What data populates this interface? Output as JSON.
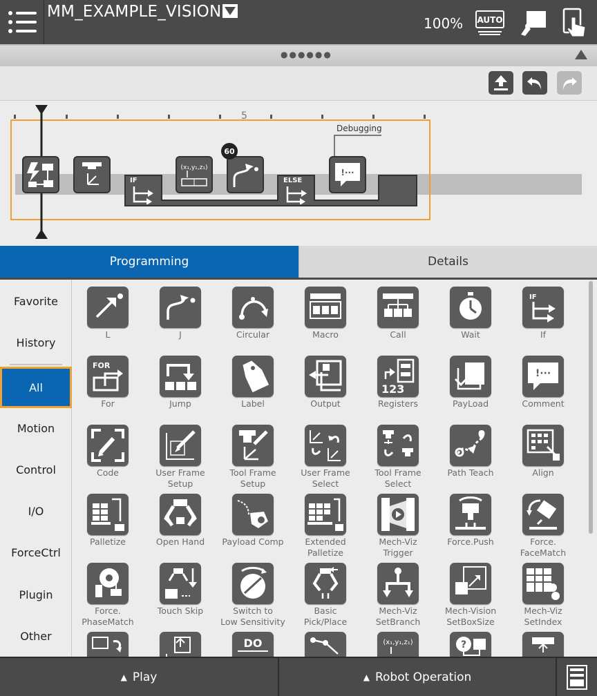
{
  "header": {
    "program_name": "MM_EXAMPLE_VISION",
    "speed": "100%",
    "mode_label": "AUTO"
  },
  "timeline": {
    "ruler_mark": "5",
    "debug_label": "Debugging",
    "wait_badge": "60",
    "if_label": "IF",
    "else_label": "ELSE",
    "coord_label": "(x₁,y₁,z₁)",
    "comment_mark": "!···"
  },
  "tabs": {
    "programming": "Programming",
    "details": "Details"
  },
  "categories": [
    {
      "label": "Favorite"
    },
    {
      "label": "History"
    },
    {
      "label": "All"
    },
    {
      "label": "Motion"
    },
    {
      "label": "Control"
    },
    {
      "label": "I/O"
    },
    {
      "label": "ForceCtrl"
    },
    {
      "label": "Plugin"
    },
    {
      "label": "Other"
    }
  ],
  "selected_category": "All",
  "palette": [
    {
      "label": "L",
      "icon": "linear-move-icon"
    },
    {
      "label": "J",
      "icon": "joint-move-icon"
    },
    {
      "label": "Circular",
      "icon": "circular-move-icon"
    },
    {
      "label": "Macro",
      "icon": "macro-icon"
    },
    {
      "label": "Call",
      "icon": "call-icon"
    },
    {
      "label": "Wait",
      "icon": "stopwatch-icon"
    },
    {
      "label": "If",
      "icon": "if-icon"
    },
    {
      "label": "For",
      "icon": "for-loop-icon"
    },
    {
      "label": "Jump",
      "icon": "jump-icon"
    },
    {
      "label": "Label",
      "icon": "tag-icon"
    },
    {
      "label": "Output",
      "icon": "output-icon"
    },
    {
      "label": "Registers",
      "icon": "registers-icon"
    },
    {
      "label": "PayLoad",
      "icon": "payload-icon"
    },
    {
      "label": "Comment",
      "icon": "comment-icon"
    },
    {
      "label": "Code",
      "icon": "code-icon"
    },
    {
      "label": "User Frame\nSetup",
      "icon": "user-frame-setup-icon"
    },
    {
      "label": "Tool Frame\nSetup",
      "icon": "tool-frame-setup-icon"
    },
    {
      "label": "User Frame\nSelect",
      "icon": "user-frame-select-icon"
    },
    {
      "label": "Tool Frame\nSelect",
      "icon": "tool-frame-select-icon"
    },
    {
      "label": "Path Teach",
      "icon": "path-teach-icon"
    },
    {
      "label": "Align",
      "icon": "align-icon"
    },
    {
      "label": "Palletize",
      "icon": "palletize-icon"
    },
    {
      "label": "Open Hand",
      "icon": "open-hand-icon"
    },
    {
      "label": "Payload Comp",
      "icon": "payload-comp-icon"
    },
    {
      "label": "Extended\nPalletize",
      "icon": "extended-palletize-icon"
    },
    {
      "label": "Mech-Viz\nTrigger",
      "icon": "mech-viz-trigger-icon"
    },
    {
      "label": "Force.Push",
      "icon": "force-push-icon"
    },
    {
      "label": "Force.\nFaceMatch",
      "icon": "force-facematch-icon"
    },
    {
      "label": "Force.\nPhaseMatch",
      "icon": "force-phasematch-icon"
    },
    {
      "label": "Touch Skip",
      "icon": "touch-skip-icon"
    },
    {
      "label": "Switch to\nLow Sensitivity",
      "icon": "low-sensitivity-icon"
    },
    {
      "label": "Basic\nPick/Place",
      "icon": "pick-place-icon"
    },
    {
      "label": "Mech-Viz\nSetBranch",
      "icon": "set-branch-icon"
    },
    {
      "label": "Mech-Vision\nSetBoxSize",
      "icon": "set-box-size-icon"
    },
    {
      "label": "Mech-Viz\nSetIndex",
      "icon": "set-index-icon"
    },
    {
      "label": "",
      "icon": "user-frame-icon"
    },
    {
      "label": "",
      "icon": "offset-icon"
    },
    {
      "label": "",
      "icon": "do-icon"
    },
    {
      "label": "",
      "icon": "path-icon"
    },
    {
      "label": "",
      "icon": "position-icon"
    },
    {
      "label": "",
      "icon": "help-icon"
    },
    {
      "label": "",
      "icon": "move-icon"
    }
  ],
  "palette_texts": {
    "for_text": "FOR",
    "if_text": "IF",
    "registers_text": "123",
    "do_text": "DO",
    "coord_text": "(x₁,y₁,z₁)"
  },
  "bottom": {
    "play": "Play",
    "robot_operation": "Robot Operation"
  },
  "colors": {
    "accent": "#0a66b3",
    "selection_border": "#f0a030",
    "header_bg": "#4a4a4a",
    "icon_bg": "#5b5b5b"
  }
}
